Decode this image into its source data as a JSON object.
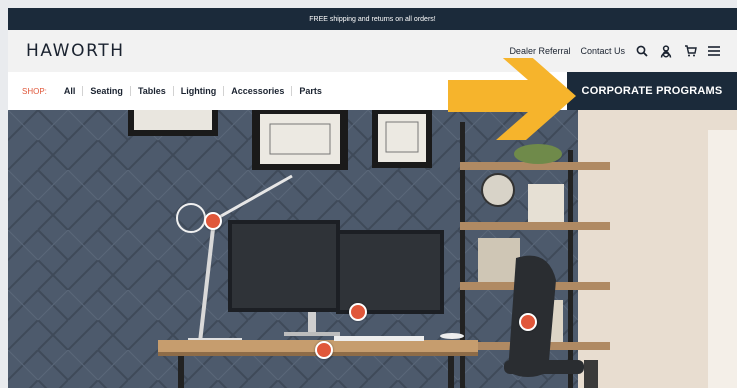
{
  "promo": {
    "text": "FREE shipping and returns on all orders!"
  },
  "header": {
    "logo": "HAWORTH",
    "links": [
      {
        "label": "Dealer Referral"
      },
      {
        "label": "Contact Us"
      }
    ],
    "icons": [
      "search-icon",
      "account-icon",
      "cart-icon",
      "menu-icon"
    ]
  },
  "shop": {
    "label": "SHOP:",
    "items": [
      "All",
      "Seating",
      "Tables",
      "Lighting",
      "Accessories",
      "Parts"
    ],
    "corporate_button": "CORPORATE PROGRAMS"
  },
  "colors": {
    "navy": "#1b2a3a",
    "accent_orange": "#e0573a",
    "arrow_yellow": "#f6b42c"
  }
}
